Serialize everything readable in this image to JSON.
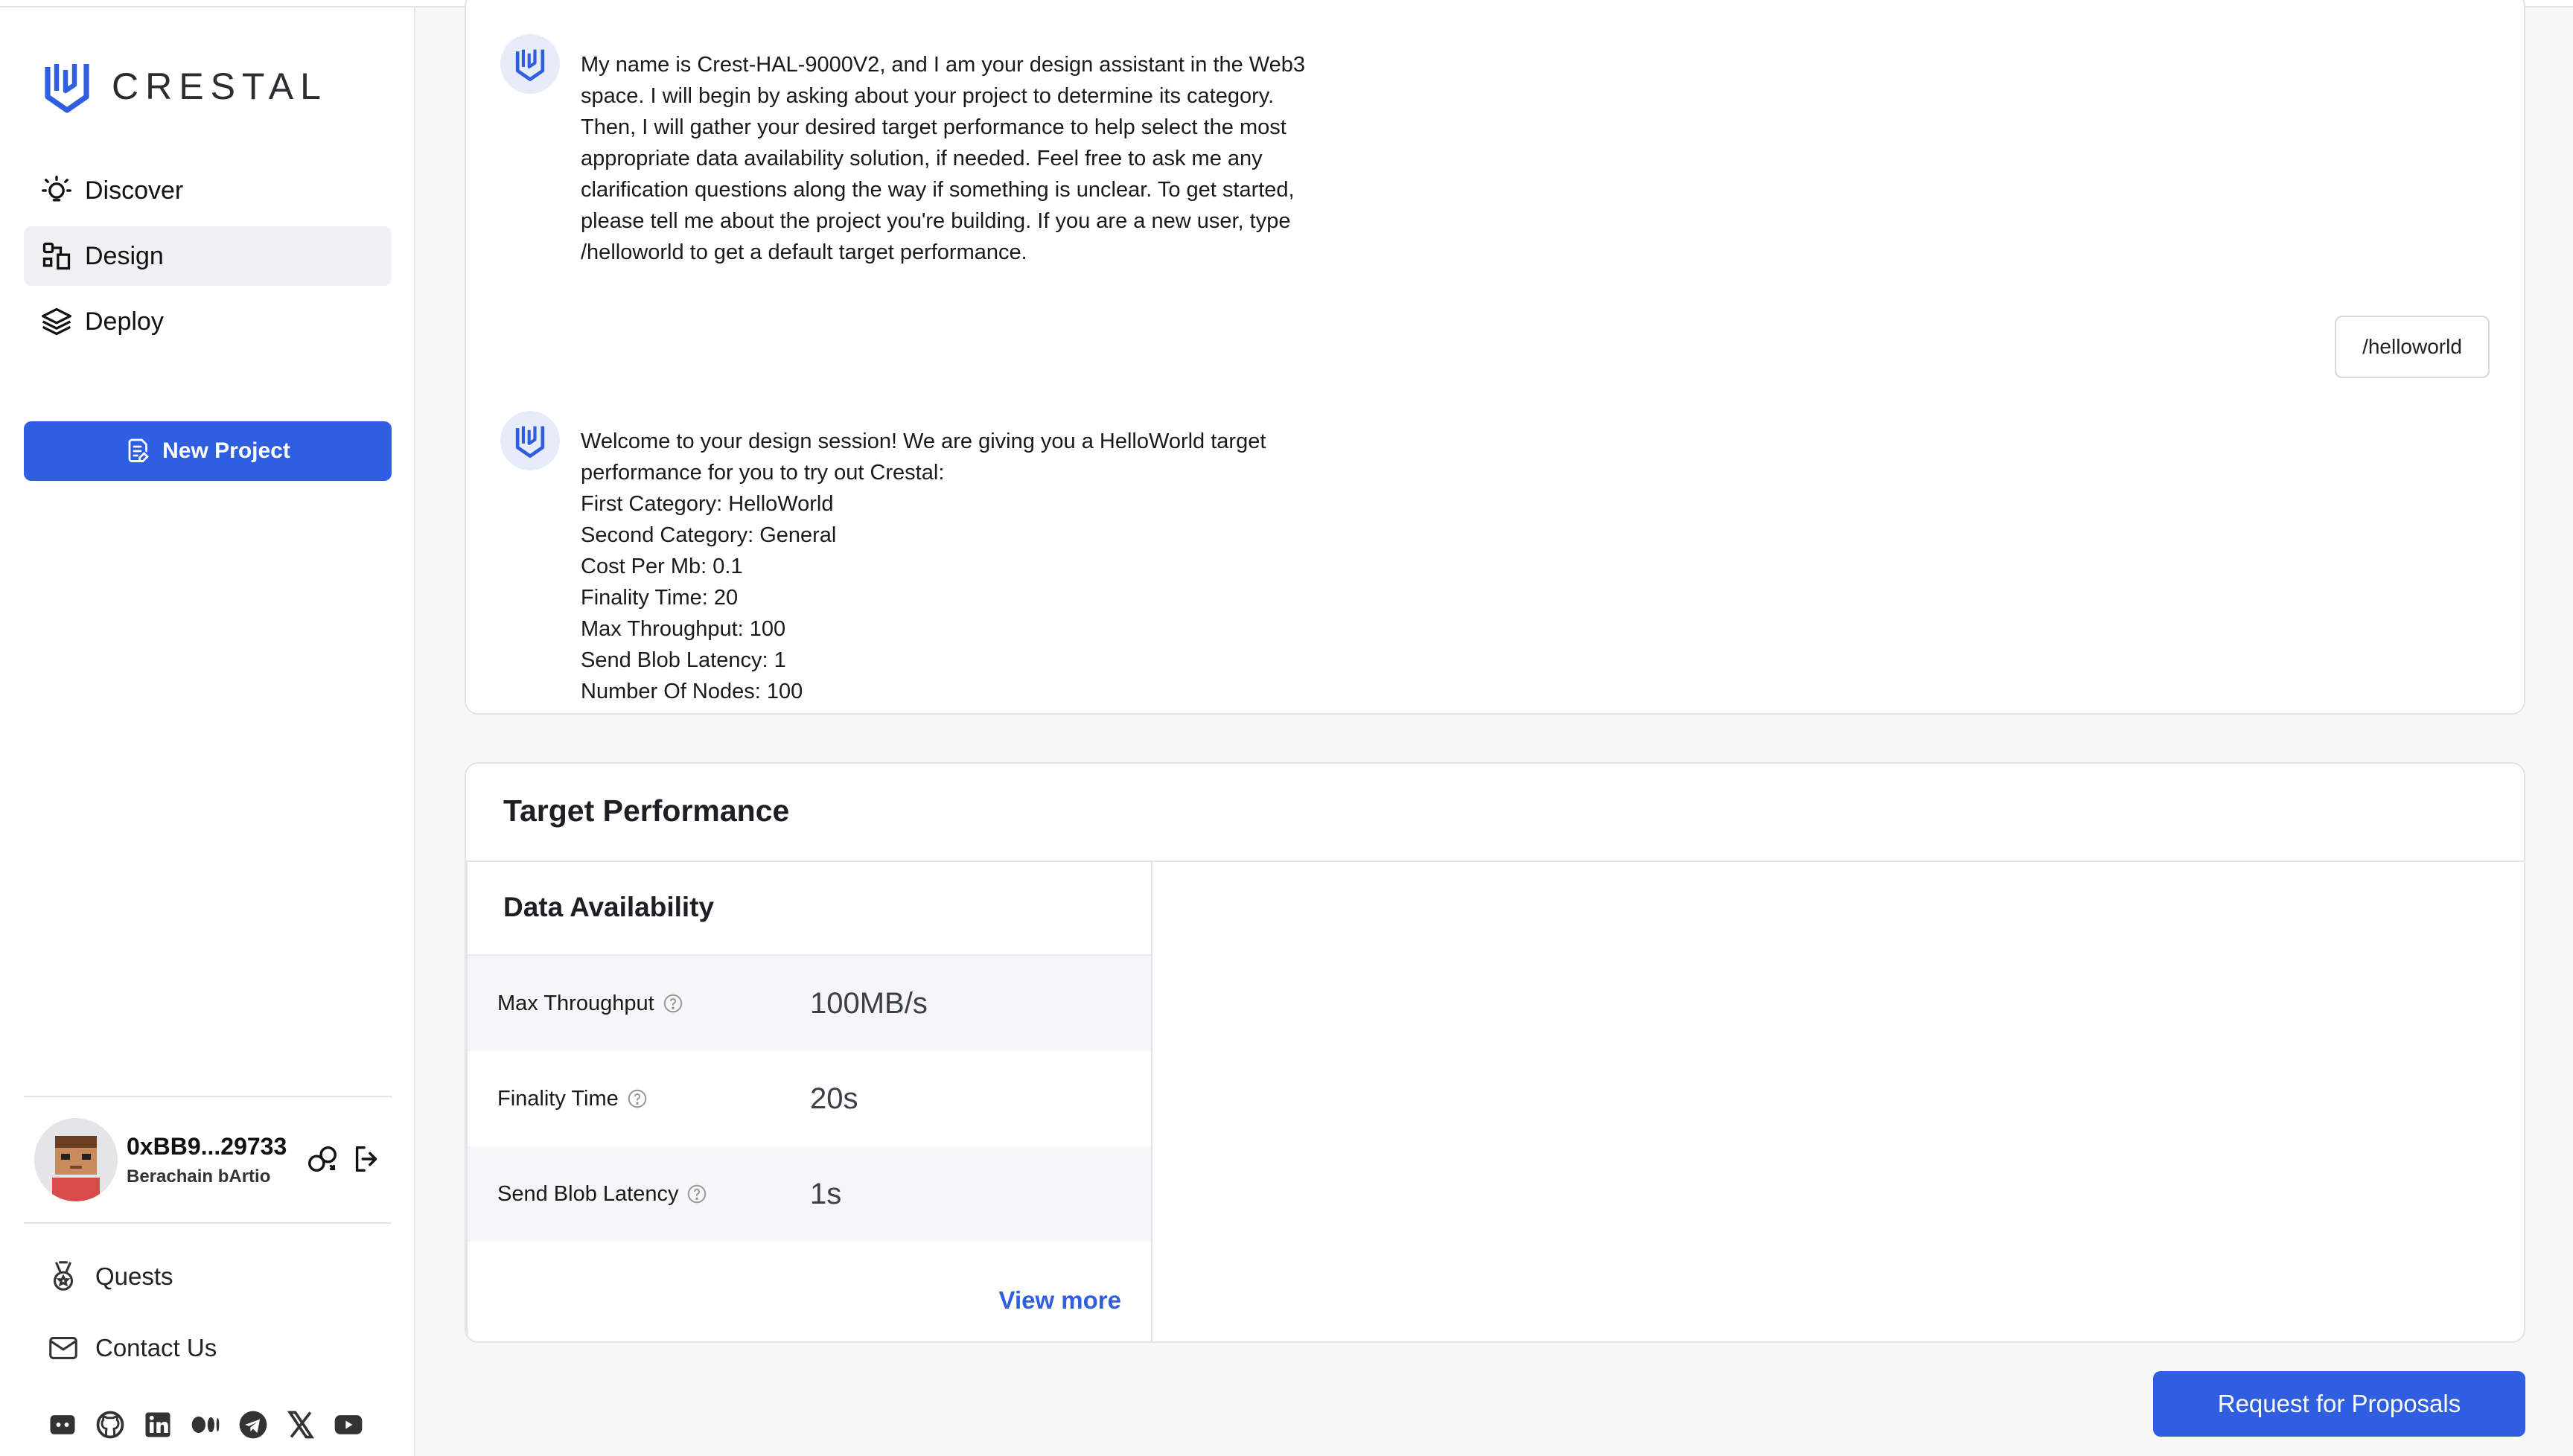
{
  "brand": {
    "name": "CRESTAL"
  },
  "nav": [
    {
      "label": "Discover",
      "icon": "lightbulb-icon"
    },
    {
      "label": "Design",
      "icon": "design-icon",
      "active": true
    },
    {
      "label": "Deploy",
      "icon": "layers-icon"
    }
  ],
  "new_project": {
    "label": "New Project",
    "icon": "document-edit-icon"
  },
  "user": {
    "address": "0xBB9...29733",
    "chain": "Berachain bArtio"
  },
  "links": [
    {
      "label": "Quests",
      "icon": "medal-icon"
    },
    {
      "label": "Contact Us",
      "icon": "mail-icon"
    }
  ],
  "socials": [
    "discord-icon",
    "github-icon",
    "linkedin-icon",
    "medium-icon",
    "telegram-icon",
    "x-icon",
    "youtube-icon"
  ],
  "chat": {
    "intro_lines": [
      "My name is Crest-HAL-9000V2, and I am your design assistant in the Web3",
      "space. I will begin by asking about your project to determine its category.",
      "Then, I will gather your desired target performance to help select the most",
      "appropriate data availability solution, if needed. Feel free to ask me any",
      "clarification questions along the way if something is unclear. To get started,",
      "please tell me about the project you're building. If you are a new user, type",
      "/helloworld to get a default target performance."
    ],
    "user_message": "/helloworld",
    "reply_lines": [
      "Welcome to your design session! We are giving you a HelloWorld target",
      "performance for you to try out Crestal:",
      "First Category: HelloWorld",
      "Second Category: General",
      "Cost Per Mb: 0.1",
      "Finality Time: 20",
      "Max Throughput: 100",
      "Send Blob Latency: 1",
      "Number Of Nodes: 100"
    ]
  },
  "target_performance": {
    "title": "Target Performance",
    "panel_title": "Data Availability",
    "rows": [
      {
        "label": "Max Throughput",
        "value": "100MB/s"
      },
      {
        "label": "Finality Time",
        "value": "20s"
      },
      {
        "label": "Send Blob Latency",
        "value": "1s"
      }
    ],
    "view_more": "View more"
  },
  "rfp_button": {
    "label": "Request for Proposals"
  },
  "colors": {
    "accent": "#2f5ee0",
    "bot_avatar_bg": "#e8ecf9"
  }
}
